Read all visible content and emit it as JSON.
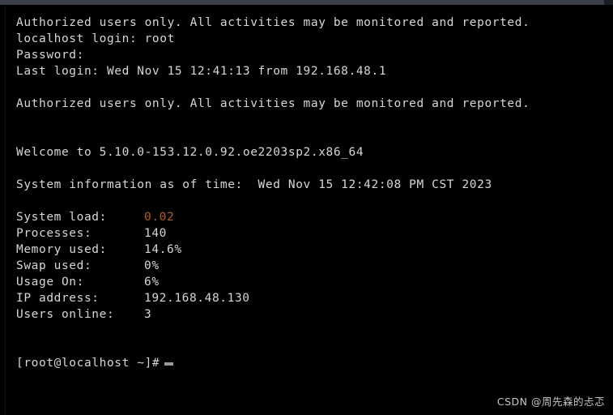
{
  "window": {
    "chrome_color": "#3a4049",
    "background_color": "#000000",
    "text_color": "#d6d6d6",
    "accent_warning_color": "#b35b12"
  },
  "console": {
    "lines": [
      {
        "text": "Authorized users only. All activities may be monitored and reported."
      },
      {
        "text": "localhost login: root"
      },
      {
        "text": "Password:"
      },
      {
        "text": "Last login: Wed Nov 15 12:41:13 from 192.168.48.1"
      },
      {
        "text": ""
      },
      {
        "text": "Authorized users only. All activities may be monitored and reported."
      },
      {
        "text": ""
      },
      {
        "text": ""
      },
      {
        "text": "Welcome to 5.10.0-153.12.0.92.oe2203sp2.x86_64"
      },
      {
        "text": ""
      },
      {
        "text": "System information as of time:  Wed Nov 15 12:42:08 PM CST 2023"
      },
      {
        "text": ""
      }
    ],
    "stats": [
      {
        "label": "System load:",
        "value": "0.02",
        "highlight": true
      },
      {
        "label": "Processes:",
        "value": "140",
        "highlight": false
      },
      {
        "label": "Memory used:",
        "value": "14.6%",
        "highlight": false
      },
      {
        "label": "Swap used:",
        "value": "0%",
        "highlight": false
      },
      {
        "label": "Usage On:",
        "value": "6%",
        "highlight": false
      },
      {
        "label": "IP address:",
        "value": "192.168.48.130",
        "highlight": false
      },
      {
        "label": "Users online:",
        "value": "3",
        "highlight": false
      }
    ],
    "prompt": "[root@localhost ~]#",
    "cursor": "block-cursor"
  },
  "watermark": {
    "text": "CSDN @周先森的忐忑"
  }
}
